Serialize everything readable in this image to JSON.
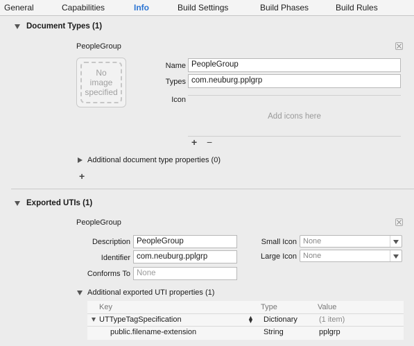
{
  "tabs": [
    {
      "label": "General",
      "selected": false
    },
    {
      "label": "Capabilities",
      "selected": false
    },
    {
      "label": "Info",
      "selected": true
    },
    {
      "label": "Build Settings",
      "selected": false
    },
    {
      "label": "Build Phases",
      "selected": false
    },
    {
      "label": "Build Rules",
      "selected": false
    }
  ],
  "document_types": {
    "title": "Document Types (1)",
    "item_title": "PeopleGroup",
    "image_placeholder": "No image specified",
    "name_label": "Name",
    "name_value": "PeopleGroup",
    "types_label": "Types",
    "types_value": "com.neuburg.pplgrp",
    "icon_label": "Icon",
    "icon_placeholder": "Add icons here",
    "add_symbol": "+",
    "remove_symbol": "−",
    "additional_props": "Additional document type properties (0)",
    "add_type_symbol": "+"
  },
  "exported_utis": {
    "title": "Exported UTIs (1)",
    "item_title": "PeopleGroup",
    "description_label": "Description",
    "description_value": "PeopleGroup",
    "identifier_label": "Identifier",
    "identifier_value": "com.neuburg.pplgrp",
    "conforms_label": "Conforms To",
    "conforms_placeholder": "None",
    "small_icon_label": "Small Icon",
    "small_icon_value": "None",
    "large_icon_label": "Large Icon",
    "large_icon_value": "None",
    "additional_props": "Additional exported UTI properties (1)",
    "table": {
      "headers": {
        "key": "Key",
        "type": "Type",
        "value": "Value"
      },
      "rows": [
        {
          "key": "UTTypeTagSpecification",
          "type": "Dictionary",
          "value": "(1 item)"
        },
        {
          "key": "public.filename-extension",
          "type": "String",
          "value": "pplgrp"
        }
      ]
    }
  },
  "colors": {
    "accent": "#2b74d3",
    "background": "#ececec"
  }
}
